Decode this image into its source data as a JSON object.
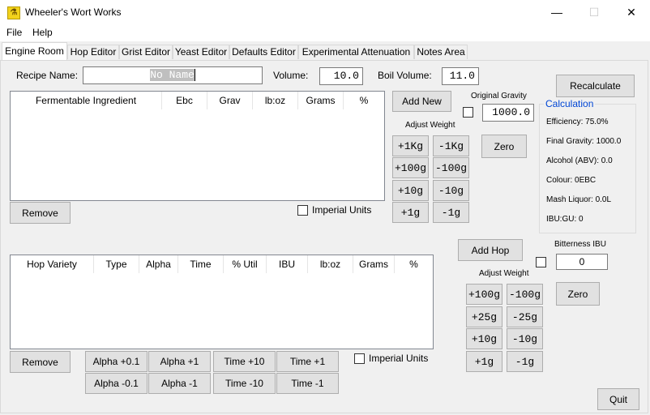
{
  "window": {
    "title": "Wheeler's Wort Works",
    "minimize": "—",
    "maximize": "☐",
    "close": "✕"
  },
  "menu": [
    "File",
    "Help"
  ],
  "tabs": [
    "Engine Room",
    "Hop Editor",
    "Grist Editor",
    "Yeast Editor",
    "Defaults Editor",
    "Experimental Attenuation",
    "Notes Area"
  ],
  "recipe": {
    "name_label": "Recipe Name:",
    "name_placeholder": "No Name",
    "volume_label": "Volume:",
    "volume_value": "10.0",
    "boil_label": "Boil Volume:",
    "boil_value": "11.0"
  },
  "fermentables": {
    "columns": [
      "Fermentable Ingredient",
      "Ebc",
      "Grav",
      "lb:oz",
      "Grams",
      "%"
    ],
    "add_new": "Add New",
    "remove": "Remove",
    "adjust_weight": "Adjust Weight",
    "weights": [
      "+1Kg",
      "-1Kg",
      "+100g",
      "-100g",
      "+10g",
      "-10g",
      "+1g",
      "-1g"
    ],
    "imperial_units": "Imperial Units"
  },
  "gravity": {
    "label": "Original Gravity",
    "value": "1000.0",
    "zero": "Zero"
  },
  "recalculate": "Recalculate",
  "calculation": {
    "title": "Calculation",
    "efficiency": "Efficiency: 75.0%",
    "final_gravity": "Final Gravity: 1000.0",
    "alcohol": "Alcohol (ABV): 0.0",
    "colour": "Colour: 0EBC",
    "mash_liquor": "Mash Liquor: 0.0L",
    "ibu_gu": "IBU:GU: 0"
  },
  "hops": {
    "columns": [
      "Hop Variety",
      "Type",
      "Alpha",
      "Time",
      "% Util",
      "IBU",
      "lb:oz",
      "Grams",
      "%"
    ],
    "remove": "Remove",
    "alpha_plus_01": "Alpha +0.1",
    "alpha_plus_1": "Alpha +1",
    "time_plus_10": "Time +10",
    "time_plus_1": "Time +1",
    "alpha_minus_01": "Alpha -0.1",
    "alpha_minus_1": "Alpha -1",
    "time_minus_10": "Time -10",
    "time_minus_1": "Time -1",
    "imperial_units": "Imperial Units",
    "add_hop": "Add Hop",
    "adjust_weight": "Adjust Weight",
    "weights": [
      "+100g",
      "-100g",
      "+25g",
      "-25g",
      "+10g",
      "-10g",
      "+1g",
      "-1g"
    ],
    "bitterness_label": "Bitterness IBU",
    "bitterness_value": "0",
    "zero": "Zero"
  },
  "quit": "Quit"
}
